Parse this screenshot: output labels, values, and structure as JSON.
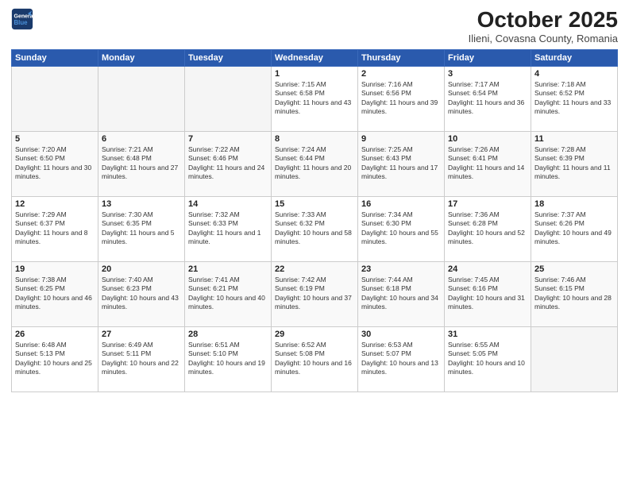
{
  "header": {
    "logo_line1": "General",
    "logo_line2": "Blue",
    "title": "October 2025",
    "subtitle": "Ilieni, Covasna County, Romania"
  },
  "weekdays": [
    "Sunday",
    "Monday",
    "Tuesday",
    "Wednesday",
    "Thursday",
    "Friday",
    "Saturday"
  ],
  "weeks": [
    [
      {
        "day": "",
        "sunrise": "",
        "sunset": "",
        "daylight": ""
      },
      {
        "day": "",
        "sunrise": "",
        "sunset": "",
        "daylight": ""
      },
      {
        "day": "",
        "sunrise": "",
        "sunset": "",
        "daylight": ""
      },
      {
        "day": "1",
        "sunrise": "Sunrise: 7:15 AM",
        "sunset": "Sunset: 6:58 PM",
        "daylight": "Daylight: 11 hours and 43 minutes."
      },
      {
        "day": "2",
        "sunrise": "Sunrise: 7:16 AM",
        "sunset": "Sunset: 6:56 PM",
        "daylight": "Daylight: 11 hours and 39 minutes."
      },
      {
        "day": "3",
        "sunrise": "Sunrise: 7:17 AM",
        "sunset": "Sunset: 6:54 PM",
        "daylight": "Daylight: 11 hours and 36 minutes."
      },
      {
        "day": "4",
        "sunrise": "Sunrise: 7:18 AM",
        "sunset": "Sunset: 6:52 PM",
        "daylight": "Daylight: 11 hours and 33 minutes."
      }
    ],
    [
      {
        "day": "5",
        "sunrise": "Sunrise: 7:20 AM",
        "sunset": "Sunset: 6:50 PM",
        "daylight": "Daylight: 11 hours and 30 minutes."
      },
      {
        "day": "6",
        "sunrise": "Sunrise: 7:21 AM",
        "sunset": "Sunset: 6:48 PM",
        "daylight": "Daylight: 11 hours and 27 minutes."
      },
      {
        "day": "7",
        "sunrise": "Sunrise: 7:22 AM",
        "sunset": "Sunset: 6:46 PM",
        "daylight": "Daylight: 11 hours and 24 minutes."
      },
      {
        "day": "8",
        "sunrise": "Sunrise: 7:24 AM",
        "sunset": "Sunset: 6:44 PM",
        "daylight": "Daylight: 11 hours and 20 minutes."
      },
      {
        "day": "9",
        "sunrise": "Sunrise: 7:25 AM",
        "sunset": "Sunset: 6:43 PM",
        "daylight": "Daylight: 11 hours and 17 minutes."
      },
      {
        "day": "10",
        "sunrise": "Sunrise: 7:26 AM",
        "sunset": "Sunset: 6:41 PM",
        "daylight": "Daylight: 11 hours and 14 minutes."
      },
      {
        "day": "11",
        "sunrise": "Sunrise: 7:28 AM",
        "sunset": "Sunset: 6:39 PM",
        "daylight": "Daylight: 11 hours and 11 minutes."
      }
    ],
    [
      {
        "day": "12",
        "sunrise": "Sunrise: 7:29 AM",
        "sunset": "Sunset: 6:37 PM",
        "daylight": "Daylight: 11 hours and 8 minutes."
      },
      {
        "day": "13",
        "sunrise": "Sunrise: 7:30 AM",
        "sunset": "Sunset: 6:35 PM",
        "daylight": "Daylight: 11 hours and 5 minutes."
      },
      {
        "day": "14",
        "sunrise": "Sunrise: 7:32 AM",
        "sunset": "Sunset: 6:33 PM",
        "daylight": "Daylight: 11 hours and 1 minute."
      },
      {
        "day": "15",
        "sunrise": "Sunrise: 7:33 AM",
        "sunset": "Sunset: 6:32 PM",
        "daylight": "Daylight: 10 hours and 58 minutes."
      },
      {
        "day": "16",
        "sunrise": "Sunrise: 7:34 AM",
        "sunset": "Sunset: 6:30 PM",
        "daylight": "Daylight: 10 hours and 55 minutes."
      },
      {
        "day": "17",
        "sunrise": "Sunrise: 7:36 AM",
        "sunset": "Sunset: 6:28 PM",
        "daylight": "Daylight: 10 hours and 52 minutes."
      },
      {
        "day": "18",
        "sunrise": "Sunrise: 7:37 AM",
        "sunset": "Sunset: 6:26 PM",
        "daylight": "Daylight: 10 hours and 49 minutes."
      }
    ],
    [
      {
        "day": "19",
        "sunrise": "Sunrise: 7:38 AM",
        "sunset": "Sunset: 6:25 PM",
        "daylight": "Daylight: 10 hours and 46 minutes."
      },
      {
        "day": "20",
        "sunrise": "Sunrise: 7:40 AM",
        "sunset": "Sunset: 6:23 PM",
        "daylight": "Daylight: 10 hours and 43 minutes."
      },
      {
        "day": "21",
        "sunrise": "Sunrise: 7:41 AM",
        "sunset": "Sunset: 6:21 PM",
        "daylight": "Daylight: 10 hours and 40 minutes."
      },
      {
        "day": "22",
        "sunrise": "Sunrise: 7:42 AM",
        "sunset": "Sunset: 6:19 PM",
        "daylight": "Daylight: 10 hours and 37 minutes."
      },
      {
        "day": "23",
        "sunrise": "Sunrise: 7:44 AM",
        "sunset": "Sunset: 6:18 PM",
        "daylight": "Daylight: 10 hours and 34 minutes."
      },
      {
        "day": "24",
        "sunrise": "Sunrise: 7:45 AM",
        "sunset": "Sunset: 6:16 PM",
        "daylight": "Daylight: 10 hours and 31 minutes."
      },
      {
        "day": "25",
        "sunrise": "Sunrise: 7:46 AM",
        "sunset": "Sunset: 6:15 PM",
        "daylight": "Daylight: 10 hours and 28 minutes."
      }
    ],
    [
      {
        "day": "26",
        "sunrise": "Sunrise: 6:48 AM",
        "sunset": "Sunset: 5:13 PM",
        "daylight": "Daylight: 10 hours and 25 minutes."
      },
      {
        "day": "27",
        "sunrise": "Sunrise: 6:49 AM",
        "sunset": "Sunset: 5:11 PM",
        "daylight": "Daylight: 10 hours and 22 minutes."
      },
      {
        "day": "28",
        "sunrise": "Sunrise: 6:51 AM",
        "sunset": "Sunset: 5:10 PM",
        "daylight": "Daylight: 10 hours and 19 minutes."
      },
      {
        "day": "29",
        "sunrise": "Sunrise: 6:52 AM",
        "sunset": "Sunset: 5:08 PM",
        "daylight": "Daylight: 10 hours and 16 minutes."
      },
      {
        "day": "30",
        "sunrise": "Sunrise: 6:53 AM",
        "sunset": "Sunset: 5:07 PM",
        "daylight": "Daylight: 10 hours and 13 minutes."
      },
      {
        "day": "31",
        "sunrise": "Sunrise: 6:55 AM",
        "sunset": "Sunset: 5:05 PM",
        "daylight": "Daylight: 10 hours and 10 minutes."
      },
      {
        "day": "",
        "sunrise": "",
        "sunset": "",
        "daylight": ""
      }
    ]
  ]
}
